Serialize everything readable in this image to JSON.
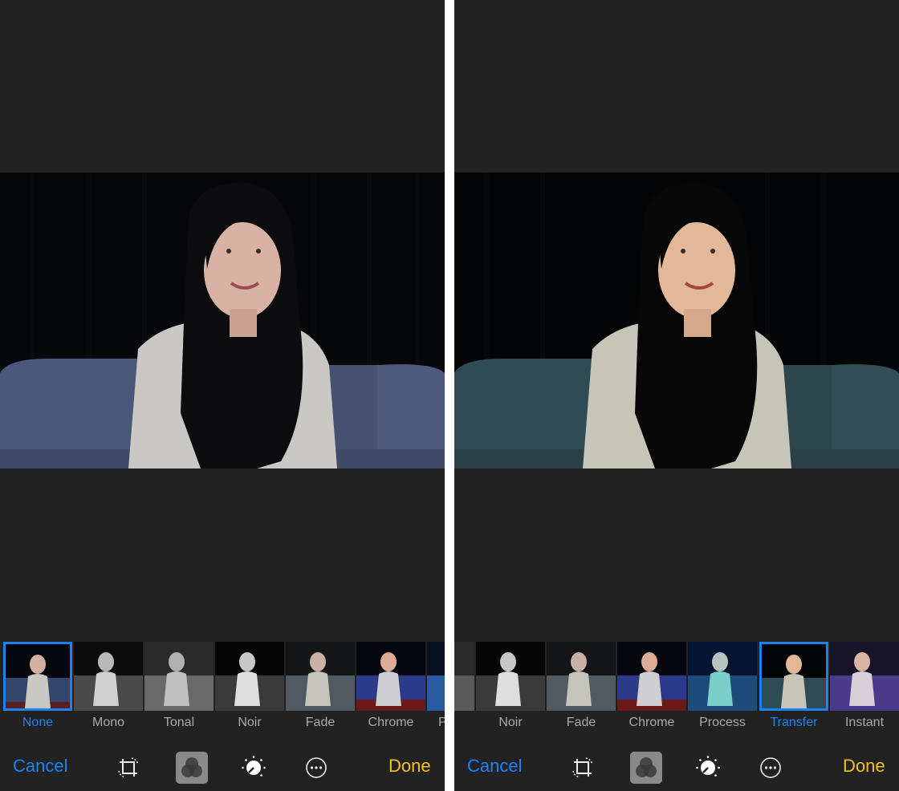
{
  "left_panel": {
    "filters": [
      {
        "label": "None",
        "selected": true
      },
      {
        "label": "Mono",
        "selected": false
      },
      {
        "label": "Tonal",
        "selected": false
      },
      {
        "label": "Noir",
        "selected": false
      },
      {
        "label": "Fade",
        "selected": false
      },
      {
        "label": "Chrome",
        "selected": false
      },
      {
        "label": "P",
        "selected": false
      }
    ],
    "toolbar": {
      "cancel_label": "Cancel",
      "done_label": "Done"
    }
  },
  "right_panel": {
    "filters": [
      {
        "label": "Noir",
        "selected": false
      },
      {
        "label": "Fade",
        "selected": false
      },
      {
        "label": "Chrome",
        "selected": false
      },
      {
        "label": "Process",
        "selected": false
      },
      {
        "label": "Transfer",
        "selected": true
      },
      {
        "label": "Instant",
        "selected": false
      }
    ],
    "toolbar": {
      "cancel_label": "Cancel",
      "done_label": "Done"
    }
  },
  "icons": {
    "crop": "crop-rotate-icon",
    "filters": "filters-icon",
    "adjust": "adjust-dial-icon",
    "more": "more-icon"
  },
  "colors": {
    "background": "#222222",
    "accent_blue": "#1c82f3",
    "done_yellow": "#f2c21b",
    "label_gray": "#a9a9a9"
  }
}
